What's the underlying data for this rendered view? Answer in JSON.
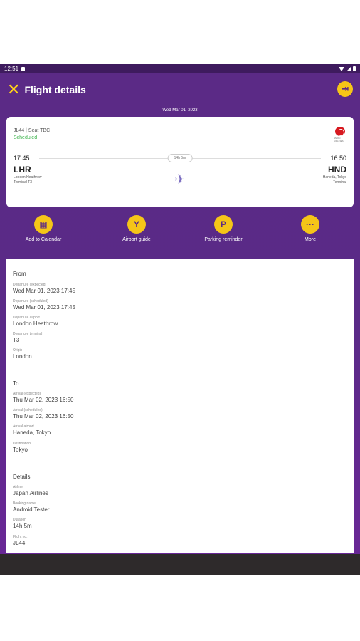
{
  "status_bar": {
    "time": "12:51"
  },
  "header": {
    "title": "Flight details"
  },
  "date": "Wed Mar 01, 2023",
  "flight": {
    "number": "JL44",
    "seat": "Seat TBC",
    "status": "Scheduled",
    "dep_time": "17:45",
    "arr_time": "16:50",
    "duration": "14h 5m",
    "dep_code": "LHR",
    "arr_code": "HND",
    "dep_airport": "London Heathrow",
    "dep_terminal": "Terminal T3",
    "arr_airport": "Haneda, Tokyo",
    "arr_terminal": "Terminal"
  },
  "actions": [
    {
      "label": "Add to Calendar",
      "icon": "calendar-icon"
    },
    {
      "label": "Airport guide",
      "icon": "cocktail-icon"
    },
    {
      "label": "Parking reminder",
      "icon": "parking-icon"
    },
    {
      "label": "More",
      "icon": "more-icon"
    }
  ],
  "sections": {
    "from": {
      "title": "From",
      "fields": [
        {
          "label": "Departure (expected)",
          "value": "Wed Mar 01, 2023 17:45"
        },
        {
          "label": "Departure (scheduled)",
          "value": "Wed Mar 01, 2023 17:45"
        },
        {
          "label": "Departure airport",
          "value": "London Heathrow"
        },
        {
          "label": "Departure terminal",
          "value": "T3"
        },
        {
          "label": "Origin",
          "value": "London"
        }
      ]
    },
    "to": {
      "title": "To",
      "fields": [
        {
          "label": "Arrival (expected)",
          "value": "Thu Mar 02, 2023 16:50"
        },
        {
          "label": "Arrival (scheduled)",
          "value": "Thu Mar 02, 2023 16:50"
        },
        {
          "label": "Arrival airport",
          "value": "Haneda, Tokyo"
        },
        {
          "label": "Destination",
          "value": "Tokyo"
        }
      ]
    },
    "details": {
      "title": "Details",
      "fields": [
        {
          "label": "Airline",
          "value": "Japan Airlines"
        },
        {
          "label": "Booking name",
          "value": "Android Tester"
        },
        {
          "label": "Duration",
          "value": "14h 5m"
        },
        {
          "label": "Flight no.",
          "value": "JL44"
        }
      ]
    }
  },
  "colors": {
    "brand_purple": "#5b2a86",
    "accent_yellow": "#f5c518",
    "status_green": "#3bb34a"
  }
}
